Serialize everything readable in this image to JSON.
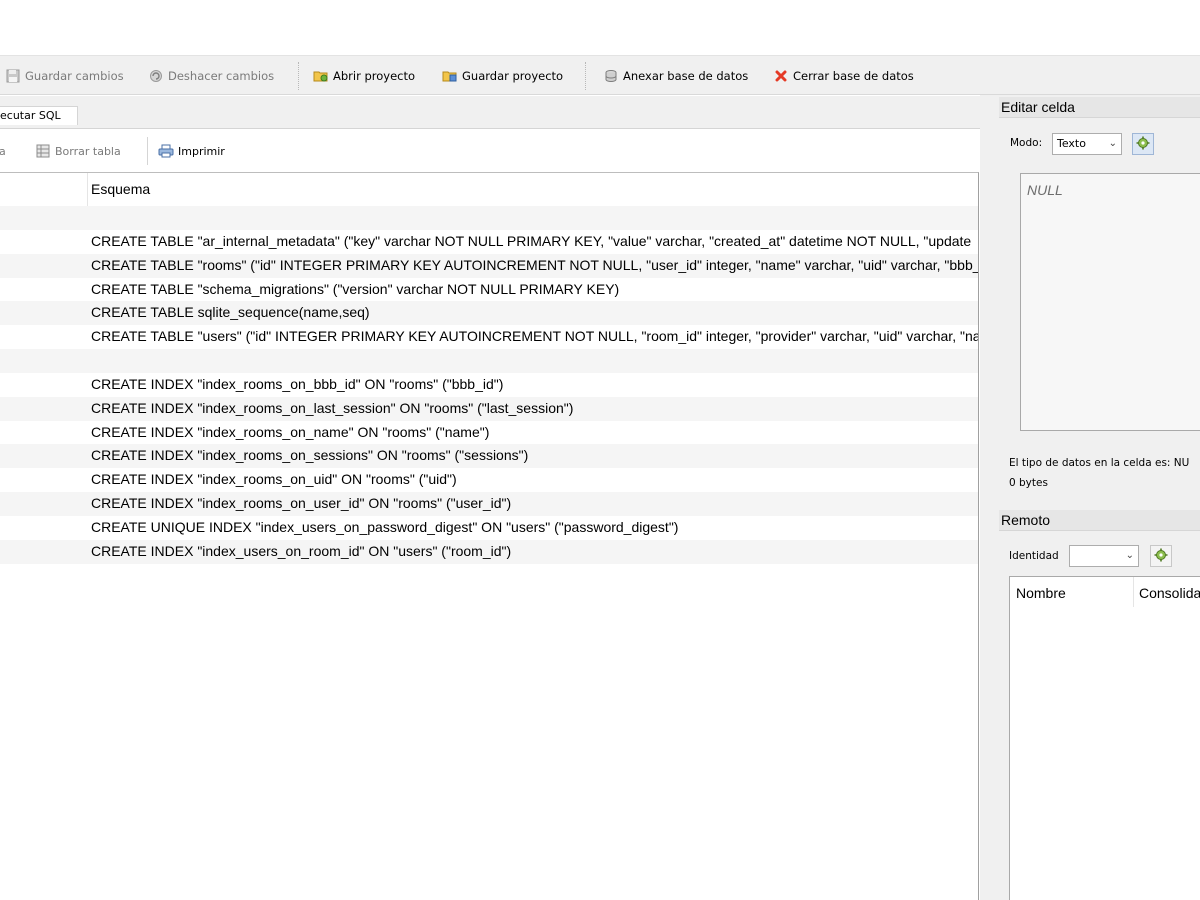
{
  "toolbar": {
    "save_changes": "Guardar cambios",
    "undo_changes": "Deshacer cambios",
    "open_project": "Abrir proyecto",
    "save_project": "Guardar proyecto",
    "attach_db": "Anexar base de datos",
    "close_db": "Cerrar base de datos"
  },
  "tabs": {
    "execute_sql": "Ejecutar SQL"
  },
  "subtoolbar": {
    "partial": "a",
    "delete_table": "Borrar tabla",
    "print": "Imprimir"
  },
  "schema": {
    "header": "Esquema",
    "rows": [
      "",
      "CREATE TABLE \"ar_internal_metadata\" (\"key\" varchar NOT NULL PRIMARY KEY, \"value\" varchar, \"created_at\" datetime NOT NULL, \"update",
      "CREATE TABLE \"rooms\" (\"id\" INTEGER PRIMARY KEY AUTOINCREMENT NOT NULL, \"user_id\" integer, \"name\" varchar, \"uid\" varchar, \"bbb_",
      "CREATE TABLE \"schema_migrations\" (\"version\" varchar NOT NULL PRIMARY KEY)",
      "CREATE TABLE sqlite_sequence(name,seq)",
      "CREATE TABLE \"users\" (\"id\" INTEGER PRIMARY KEY AUTOINCREMENT NOT NULL, \"room_id\" integer, \"provider\" varchar, \"uid\" varchar, \"na",
      "",
      "CREATE INDEX \"index_rooms_on_bbb_id\" ON \"rooms\" (\"bbb_id\")",
      "CREATE INDEX \"index_rooms_on_last_session\" ON \"rooms\" (\"last_session\")",
      "CREATE INDEX \"index_rooms_on_name\" ON \"rooms\" (\"name\")",
      "CREATE INDEX \"index_rooms_on_sessions\" ON \"rooms\" (\"sessions\")",
      "CREATE INDEX \"index_rooms_on_uid\" ON \"rooms\" (\"uid\")",
      "CREATE INDEX \"index_rooms_on_user_id\" ON \"rooms\" (\"user_id\")",
      "CREATE UNIQUE INDEX \"index_users_on_password_digest\" ON \"users\" (\"password_digest\")",
      "CREATE INDEX \"index_users_on_room_id\" ON \"users\" (\"room_id\")",
      ""
    ]
  },
  "edit_cell": {
    "title": "Editar celda",
    "mode_label": "Modo:",
    "mode_value": "Texto",
    "null_text": "NULL",
    "type_info": "El tipo de datos en la celda es: NU",
    "size_info": "0 bytes"
  },
  "remote": {
    "title": "Remoto",
    "identity_label": "Identidad",
    "identity_value": "",
    "col_name": "Nombre",
    "col_committed": "Consolida"
  },
  "colors": {
    "toolbar_bg": "#f0f0f0",
    "row_alt": "#f5f5f5",
    "close_icon": "#e53a26"
  },
  "icons": {
    "save_changes": "save-icon",
    "undo_changes": "undo-icon",
    "open_project": "open-project-icon",
    "save_project": "save-project-icon",
    "attach_db": "attach-database-icon",
    "close_db": "close-x-icon",
    "delete_table": "delete-table-icon",
    "print": "printer-icon",
    "mode_apply": "gear-icon",
    "identity_apply": "gear-icon"
  }
}
